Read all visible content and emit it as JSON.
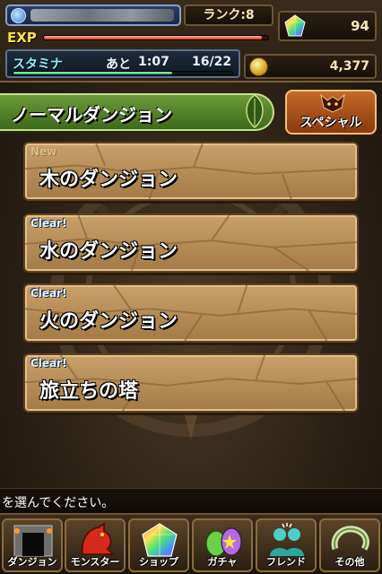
{
  "header": {
    "rank_label": "ランク:8",
    "exp_label": "EXP",
    "exp_progress": 0.97,
    "stamina_label": "スタミナ",
    "stamina_time_label": "あと",
    "stamina_time": "1:07",
    "stamina_value": "16/22",
    "stamina_progress": 0.727,
    "magic_stones": "94",
    "coins": "4,377"
  },
  "section": {
    "title": "ノーマルダンジョン",
    "special_button": "スペシャル"
  },
  "dungeons": [
    {
      "tag": "New",
      "name": "木のダンジョン"
    },
    {
      "tag": "Clear!",
      "name": "水のダンジョン"
    },
    {
      "tag": "Clear!",
      "name": "火のダンジョン"
    },
    {
      "tag": "Clear!",
      "name": "旅立ちの塔"
    }
  ],
  "message": "を選んでください。",
  "nav": [
    {
      "label": "ダンジョン",
      "icon": "dungeon-gate-icon"
    },
    {
      "label": "モンスター",
      "icon": "dragon-icon"
    },
    {
      "label": "ショップ",
      "icon": "gem-icon"
    },
    {
      "label": "ガチャ",
      "icon": "egg-icon"
    },
    {
      "label": "フレンド",
      "icon": "friends-icon"
    },
    {
      "label": "その他",
      "icon": "other-icon"
    }
  ],
  "colors": {
    "exp": "#ffdf4a",
    "stamina": "#8cf2ff",
    "section_green": "#4e7e28",
    "special_orange": "#b45a20",
    "dungeon_stone": "#b88e58"
  }
}
